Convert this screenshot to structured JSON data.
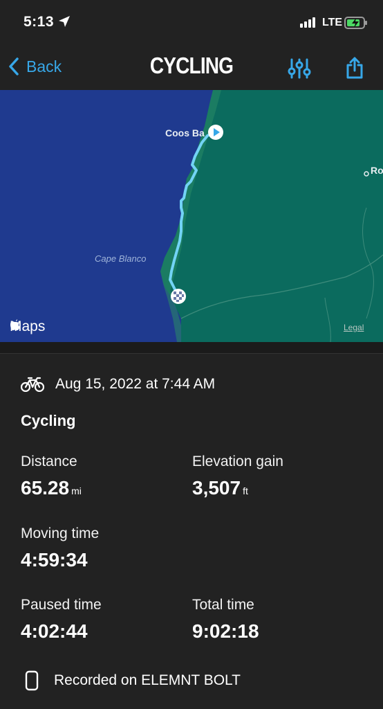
{
  "status_bar": {
    "time": "5:13",
    "network": "LTE"
  },
  "nav": {
    "back_label": "Back",
    "title": "CYCLING"
  },
  "map": {
    "labels": {
      "coos_bay": "Coos Ba",
      "cape_blanco": "Cape Blanco",
      "ro": "Ro"
    },
    "attribution": "Maps",
    "legal": "Legal",
    "colors": {
      "ocean": "#1f3a8f",
      "land": "#0b6b5e",
      "route": "#72d3f5"
    }
  },
  "activity": {
    "date": "Aug 15, 2022 at 7:44 AM",
    "type": "Cycling",
    "distance": {
      "label": "Distance",
      "value": "65.28",
      "unit": "mi"
    },
    "elevation_gain": {
      "label": "Elevation gain",
      "value": "3,507",
      "unit": "ft"
    },
    "moving_time": {
      "label": "Moving time",
      "value": "4:59:34"
    },
    "paused_time": {
      "label": "Paused time",
      "value": "4:02:44"
    },
    "total_time": {
      "label": "Total time",
      "value": "9:02:18"
    },
    "recorded_on": "Recorded on ELEMNT BOLT"
  },
  "icons": {
    "location": "location-arrow-icon",
    "back": "chevron-left-icon",
    "settings": "sliders-icon",
    "share": "share-icon",
    "bike": "bicycle-icon",
    "device": "device-icon"
  },
  "accent": "#37a7e8"
}
